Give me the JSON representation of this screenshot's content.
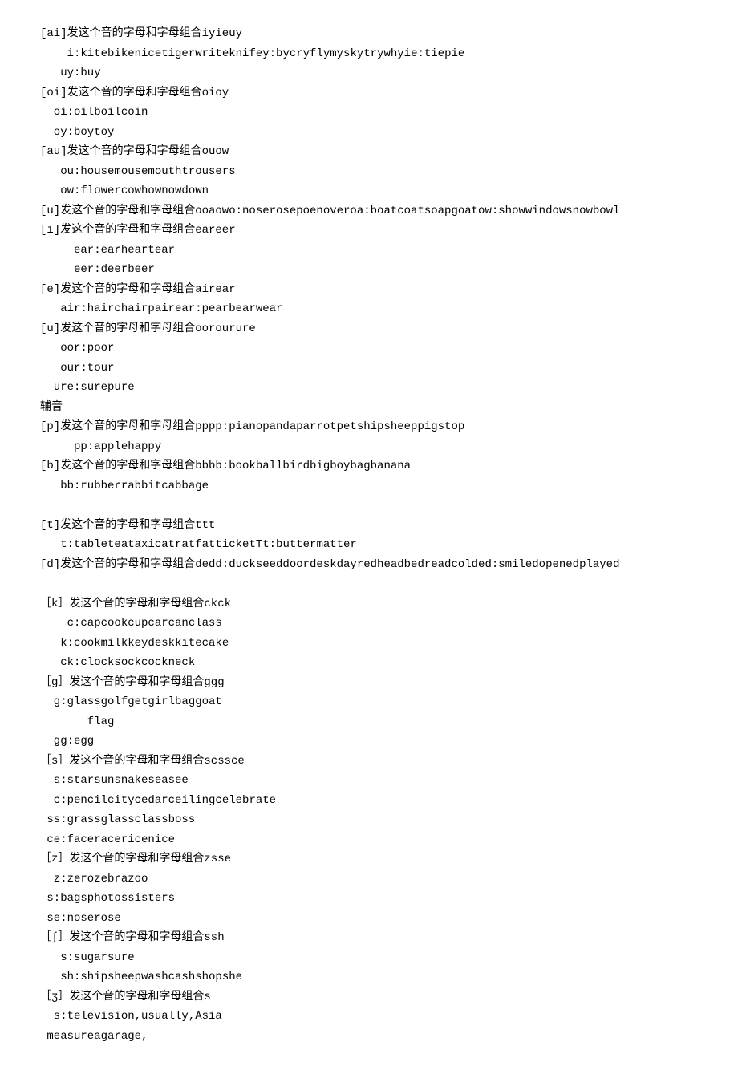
{
  "lines": [
    "[ai]发这个音的字母和字母组合iyieuy",
    "    i:kitebikenicetigerwriteknifey:bycryflymyskytrywhyie:tiepie",
    "   uy:buy",
    "[oi]发这个音的字母和字母组合oioy",
    "  oi:oilboilcoin",
    "  oy:boytoy",
    "[au]发这个音的字母和字母组合ouow",
    "   ou:housemousemou​thtrousers",
    "   ow:flowercowhownowdown",
    "[u]发这个音的字母和字母组合ooaowo:noserosepoenoveroa:boatcoatsoapgoatow:showwindowsnowbowl",
    "[i]发这个音的字母和字母组合eareer",
    "     ear:earheartear",
    "     eer:deerbeer",
    "[e]发这个音的字母和字母组合airear",
    "   air:hairchairpairear:pearbearwear",
    "[u]发这个音的字母和字母组合oorourure",
    "   oor:poor",
    "   our:tour",
    "  ure:surepure",
    "辅音",
    "[p]发这个音的字母和字母组合pppp:pianopandaparrotpetshipsheeppigstop",
    "     pp:applehappy",
    "[b]发这个音的字母和字母组合bbbb:bookballbirdbigboybagbanana",
    "   bb:rubberrabbitcabbage",
    "",
    "[t]发这个音的字母和字母组合ttt",
    "   t:tableteataxicatratfatticketTt:buttermatter",
    "[d]发这个音的字母和字母组合dedd:duckseeddoordeskdayredheadbedreadcolded:smiledopenedplayed",
    "",
    "［k］发这个音的字母和字母组合ckck",
    "    c:capcookcupcarcanclass",
    "   k:cookmilkkeydeskkitecake",
    "   ck:clocksockcockneck",
    "［g］发这个音的字母和字母组合ggg",
    "  g:glassgolfgetgirlbaggoat",
    "       flag",
    "  gg:egg",
    "［s］发这个音的字母和字母组合scssce",
    "  s:starsunsnakeseasee",
    "  c:pencilcitycedarceilingcelebrate",
    " ss:grassglassclassboss",
    " ce:faceracericenice",
    "［z］发这个音的字母和字母组合zsse",
    "  z:zerozebrazoo",
    " s:bagsphotossisters",
    " se:noserose",
    "［∫］发这个音的字母和字母组合ssh",
    "   s:sugarsure",
    "   sh:shipsheepwashcashshopshe",
    "［ʒ］发这个音的字母和字母组合s",
    "  s:television,usually,Asia",
    " measureagarage,"
  ]
}
